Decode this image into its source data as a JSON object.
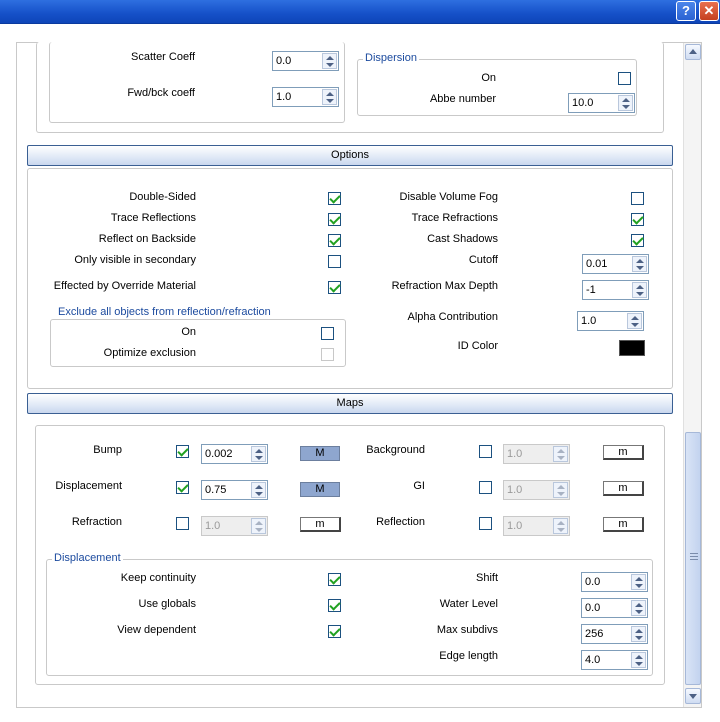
{
  "window": {
    "help_label": "?",
    "close_label": "✕"
  },
  "top": {
    "scatter_label": "Scatter Coeff",
    "scatter_value": "0.0",
    "fwd_label": "Fwd/bck coeff",
    "fwd_value": "1.0",
    "dispersion_title": "Dispersion",
    "disp_on_label": "On",
    "disp_on_checked": false,
    "abbe_label": "Abbe number",
    "abbe_value": "10.0"
  },
  "options": {
    "header": "Options",
    "double_sided": "Double-Sided",
    "trace_reflections": "Trace Reflections",
    "reflect_backside": "Reflect on Backside",
    "only_visible": "Only visible in secondary",
    "effected_override": "Effected by Override Material",
    "disable_fog": "Disable Volume Fog",
    "trace_refractions": "Trace Refractions",
    "cast_shadows": "Cast Shadows",
    "cutoff": "Cutoff",
    "cutoff_value": "0.01",
    "refr_depth": "Refraction Max Depth",
    "refr_depth_value": "-1",
    "alpha": "Alpha Contribution",
    "alpha_value": "1.0",
    "id_color": "ID Color",
    "id_color_value": "#000000",
    "exclude_title": "Exclude all objects from reflection/refraction",
    "exclude_on": "On",
    "optimize": "Optimize exclusion"
  },
  "maps": {
    "header": "Maps",
    "bump": "Bump",
    "bump_value": "0.002",
    "bump_btn": "M",
    "displacement": "Displacement",
    "displacement_value": "0.75",
    "displacement_btn": "M",
    "refraction": "Refraction",
    "refraction_value": "1.0",
    "refraction_btn": "m",
    "background": "Background",
    "background_value": "1.0",
    "background_btn": "m",
    "gi": "GI",
    "gi_value": "1.0",
    "gi_btn": "m",
    "reflection": "Reflection",
    "reflection_value": "1.0",
    "reflection_btn": "m"
  },
  "displacement": {
    "title": "Displacement",
    "keep_continuity": "Keep continuity",
    "use_globals": "Use globals",
    "view_dependent": "View dependent",
    "shift": "Shift",
    "shift_value": "0.0",
    "water_level": "Water Level",
    "water_level_value": "0.0",
    "max_subdivs": "Max subdivs",
    "max_subdivs_value": "256",
    "edge_length": "Edge length",
    "edge_length_value": "4.0"
  }
}
